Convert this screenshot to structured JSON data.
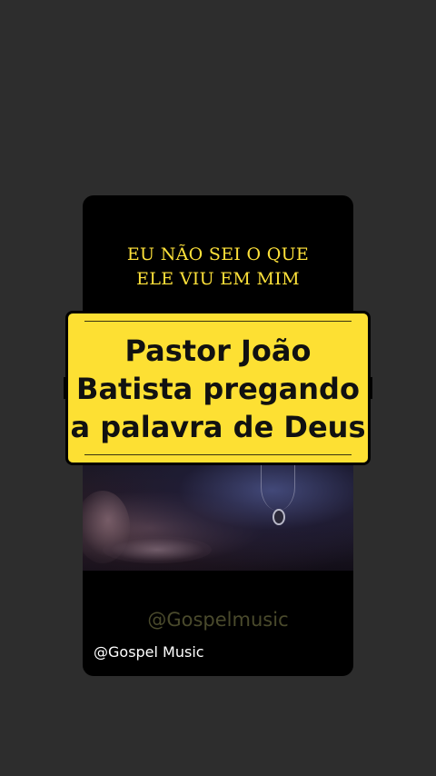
{
  "video": {
    "caption_lines": [
      "EU NÃO SEI O QUE",
      "ELE VIU EM MIM"
    ],
    "watermark_center": "@Gospelmusic",
    "watermark_left": "@Gospel Music"
  },
  "title_banner": {
    "lines": [
      "Pastor João",
      "Batista pregando",
      "a palavra de Deus"
    ]
  },
  "colors": {
    "background": "#2d2d2d",
    "banner_fill": "#fde033",
    "caption_text": "#ffe23a"
  }
}
